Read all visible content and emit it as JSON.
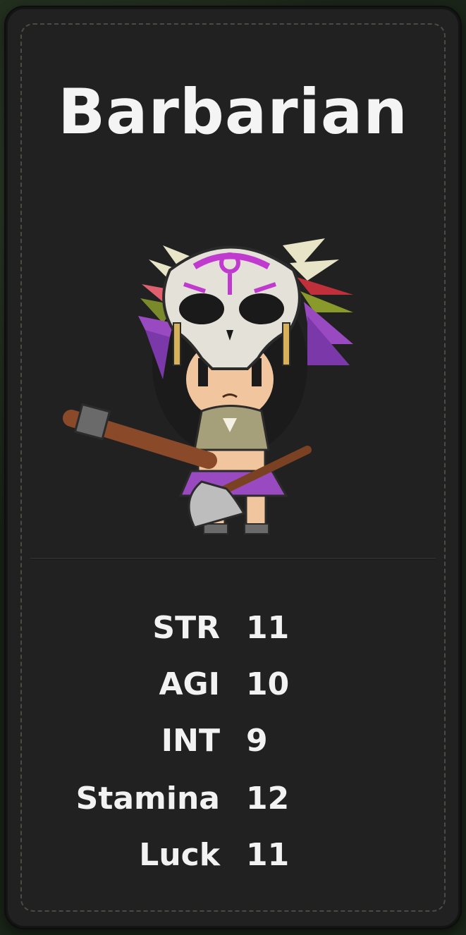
{
  "card": {
    "title": "Barbarian",
    "portrait_icon": "barbarian-skull-mask-character"
  },
  "stats": [
    {
      "label": "STR",
      "value": "11"
    },
    {
      "label": "AGI",
      "value": "10"
    },
    {
      "label": "INT",
      "value": "9"
    },
    {
      "label": "Stamina",
      "value": "12"
    },
    {
      "label": "Luck",
      "value": "11"
    }
  ],
  "colors": {
    "card_background": "#212121",
    "text": "#f2f2f2",
    "mask_paint": "#c03ad0"
  }
}
